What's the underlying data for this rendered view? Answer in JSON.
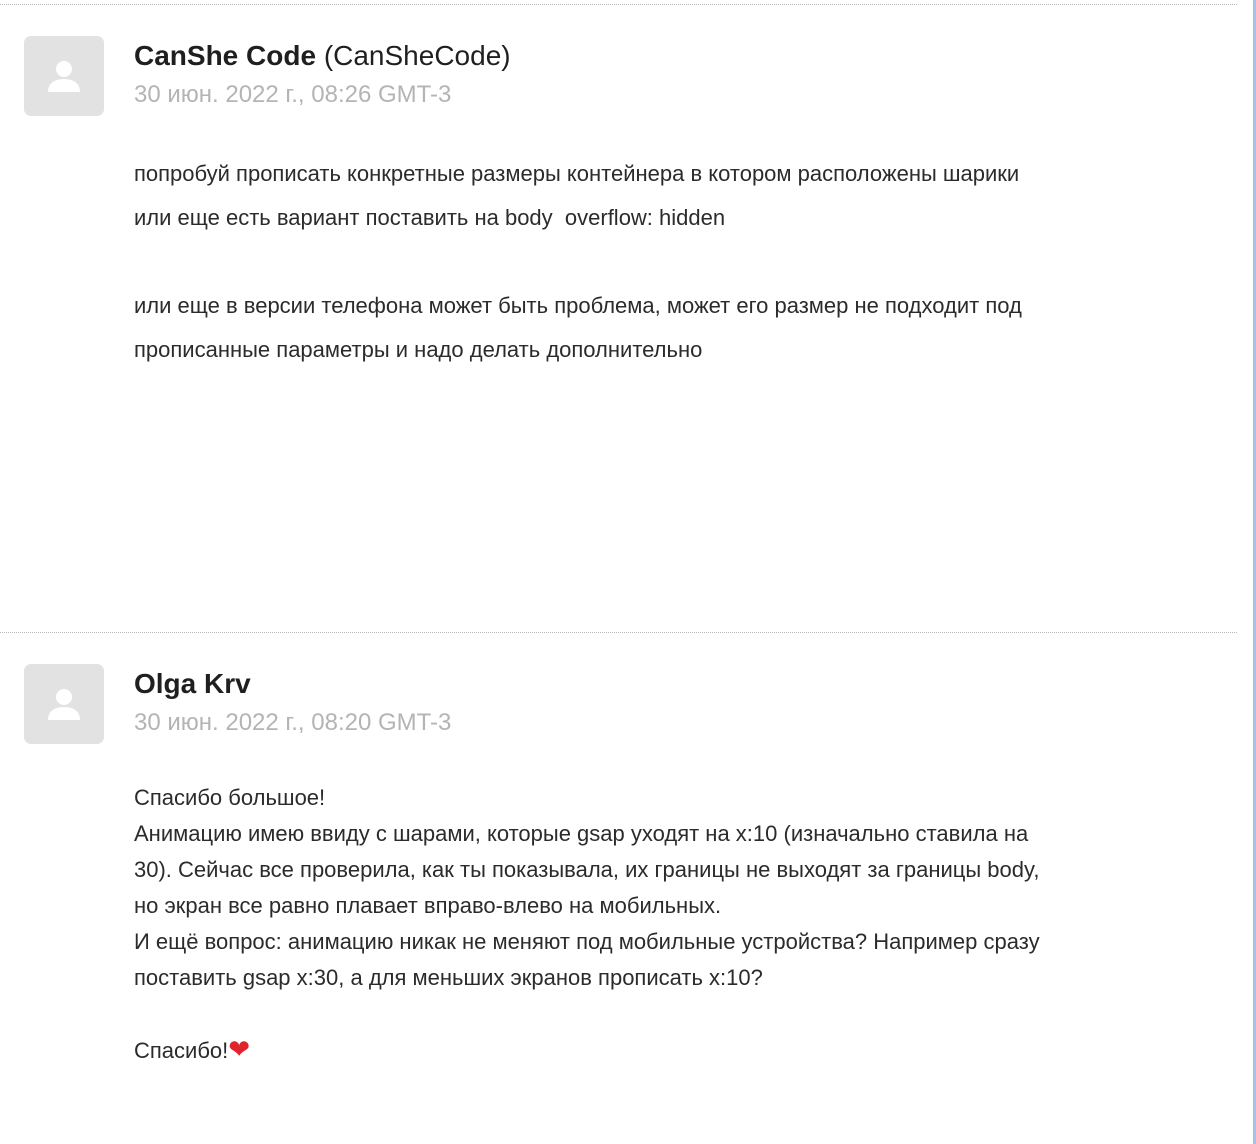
{
  "posts": [
    {
      "author_name": "CanShe Code",
      "author_handle": "(CanSheCode)",
      "timestamp": "30 июн. 2022 г., 08:26 GMT-3",
      "paragraphs": [
        [
          "попробуй прописать конкретные размеры контейнера в котором расположены шарики",
          "или еще есть вариант поставить на body  overflow: hidden"
        ],
        [
          "или еще в версии телефона может быть проблема, может его размер не подходит под",
          "прописанные параметры и надо делать дополнительно"
        ]
      ]
    },
    {
      "author_name": "Olga Krv",
      "timestamp": "30 июн. 2022 г., 08:20 GMT-3",
      "lines": [
        "Спасибо большое!",
        "Анимацию имею ввиду с шарами, которые gsap уходят на x:10 (изначально ставила на",
        "30). Сейчас все проверила, как ты показывала, их границы не выходят за границы body,",
        "но экран все равно плавает вправо-влево на мобильных.",
        "И ещё вопрос: анимацию никак не меняют под мобильные устройства? Например сразу",
        "поставить gsap x:30, а для меньших экранов прописать x:10?"
      ],
      "closing": "Спасибо!",
      "closing_emoji": "❤"
    }
  ],
  "icons": {
    "avatar": "user-silhouette-icon",
    "heart": "heart-icon"
  },
  "colors": {
    "avatar_bg": "#e2e2e2",
    "avatar_fg": "#ffffff",
    "timestamp": "#b4b4b4",
    "heart": "#e0242b"
  }
}
